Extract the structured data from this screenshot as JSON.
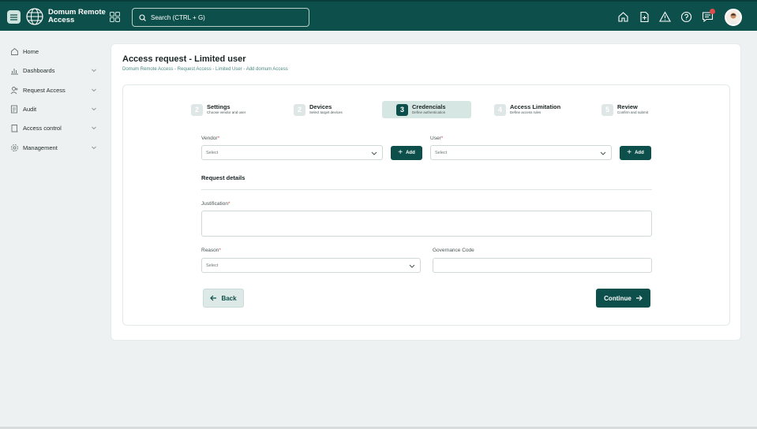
{
  "app": {
    "title": "Domum Remote Access"
  },
  "search": {
    "placeholder": "Search (CTRL + G)"
  },
  "topbar": {
    "icons": [
      "home-icon",
      "document-icon",
      "alert-icon",
      "help-icon",
      "chat-icon"
    ],
    "notification_count": ""
  },
  "sidebar": {
    "items": [
      {
        "label": "Home",
        "icon": "home-icon",
        "has_chevron": false
      },
      {
        "label": "Dashboards",
        "icon": "chart-icon",
        "has_chevron": true
      },
      {
        "label": "Request Access",
        "icon": "user-add-icon",
        "has_chevron": true
      },
      {
        "label": "Audit",
        "icon": "audit-icon",
        "has_chevron": true
      },
      {
        "label": "Access control",
        "icon": "lock-icon",
        "has_chevron": true
      },
      {
        "label": "Management",
        "icon": "gear-icon",
        "has_chevron": true
      }
    ]
  },
  "page": {
    "title": "Access request - Limited user",
    "breadcrumb": "Domum Remote Access - Request Access - Limited User - Add domum Access"
  },
  "steps": [
    {
      "number": "2",
      "label": "Settings",
      "sub": "Choose vendor and user",
      "active": false
    },
    {
      "number": "2",
      "label": "Devices",
      "sub": "Select target devices",
      "active": false
    },
    {
      "number": "3",
      "label": "Credencials",
      "sub": "Define authentication",
      "active": true
    },
    {
      "number": "4",
      "label": "Access Limitation",
      "sub": "Define access rules",
      "active": false
    },
    {
      "number": "5",
      "label": "Review",
      "sub": "Confirm and submit",
      "active": false
    }
  ],
  "form": {
    "vendor": {
      "label": "Vendor",
      "required_mark": "*",
      "placeholder": "Select",
      "add_label": "Add"
    },
    "user": {
      "label": "User",
      "required_mark": "*",
      "placeholder": "Select",
      "add_label": "Add"
    },
    "section_title": "Request details",
    "justification": {
      "label": "Justification",
      "required_mark": "*",
      "value": ""
    },
    "reason": {
      "label": "Reason",
      "required_mark": "*",
      "placeholder": "Select"
    },
    "governance": {
      "label": "Governance Code",
      "value": ""
    }
  },
  "actions": {
    "back_label": "Back",
    "continue_label": "Continue"
  },
  "colors": {
    "brand": "#0d4f4a",
    "accent_light": "#d6e6e3",
    "required": "#d9534f"
  }
}
